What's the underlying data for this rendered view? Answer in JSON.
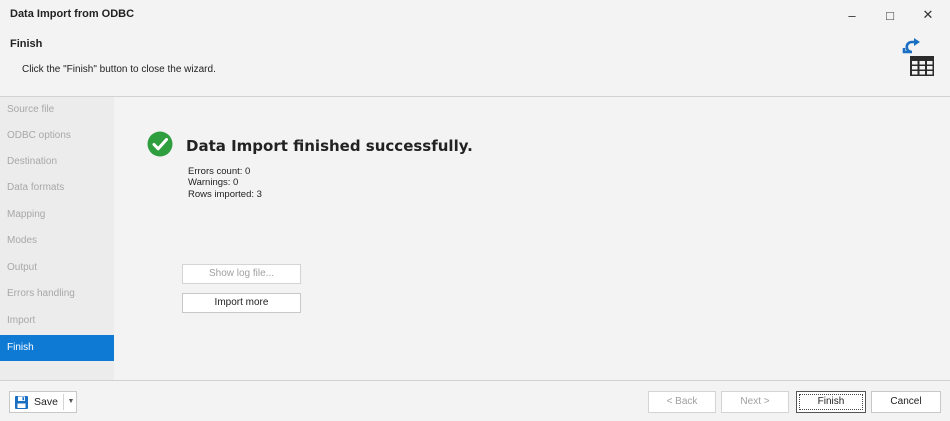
{
  "window": {
    "title": "Data Import from ODBC",
    "minimize": "–",
    "maximize": "□",
    "close": "✕"
  },
  "header": {
    "step_title": "Finish",
    "step_description": "Click the \"Finish\" button to close the wizard.",
    "icon": "import-to-table-icon"
  },
  "sidebar": {
    "items": [
      {
        "label": "Source file",
        "active": false
      },
      {
        "label": "ODBC options",
        "active": false
      },
      {
        "label": "Destination",
        "active": false
      },
      {
        "label": "Data formats",
        "active": false
      },
      {
        "label": "Mapping",
        "active": false
      },
      {
        "label": "Modes",
        "active": false
      },
      {
        "label": "Output",
        "active": false
      },
      {
        "label": "Errors handling",
        "active": false
      },
      {
        "label": "Import",
        "active": false
      },
      {
        "label": "Finish",
        "active": true
      }
    ],
    "active_color": "#0f7ad4"
  },
  "result": {
    "icon": "check-circle-icon",
    "icon_color": "#2e9e3e",
    "title": "Data Import finished successfully.",
    "stats": {
      "errors": "Errors count: 0",
      "warnings": "Warnings: 0",
      "rows": "Rows imported: 3"
    },
    "show_log_label": "Show log file...",
    "import_more_label": "Import more"
  },
  "footer": {
    "save_label": "Save",
    "back_label": "< Back",
    "next_label": "Next >",
    "finish_label": "Finish",
    "cancel_label": "Cancel"
  }
}
